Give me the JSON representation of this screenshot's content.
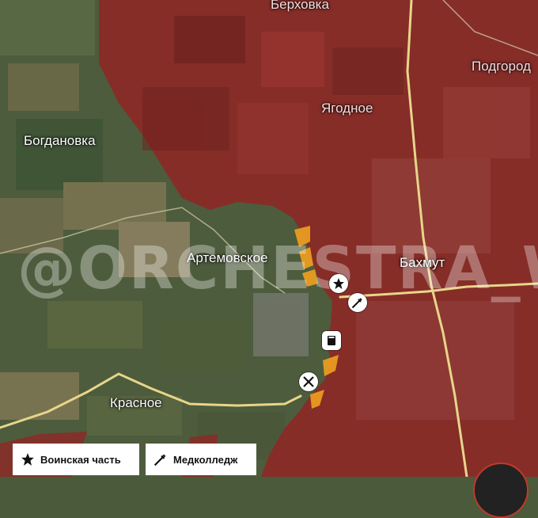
{
  "places": {
    "verkhovka": "Берховка",
    "podgorodnoe": "Подгород",
    "yagodnoe": "Ягодное",
    "bogdanovka": "Богдановка",
    "artemovskoe": "Артемовское",
    "bakhmut": "Бахмут",
    "krasnoe": "Красное"
  },
  "watermark": "@ORCHESTRA_W",
  "legend": {
    "military_unit": {
      "icon": "star-icon",
      "label": "Воинская часть"
    },
    "medical_college": {
      "icon": "syringe-icon",
      "label": "Медколледж"
    }
  },
  "markers": [
    "star-icon",
    "syringe-icon",
    "book-icon",
    "crossed-swords-icon"
  ],
  "colors": {
    "controlled_zone": "#8b2a27",
    "contested_zone": "#f0a020",
    "road": "#e8d58a",
    "terrain": "#4a5a3a"
  }
}
